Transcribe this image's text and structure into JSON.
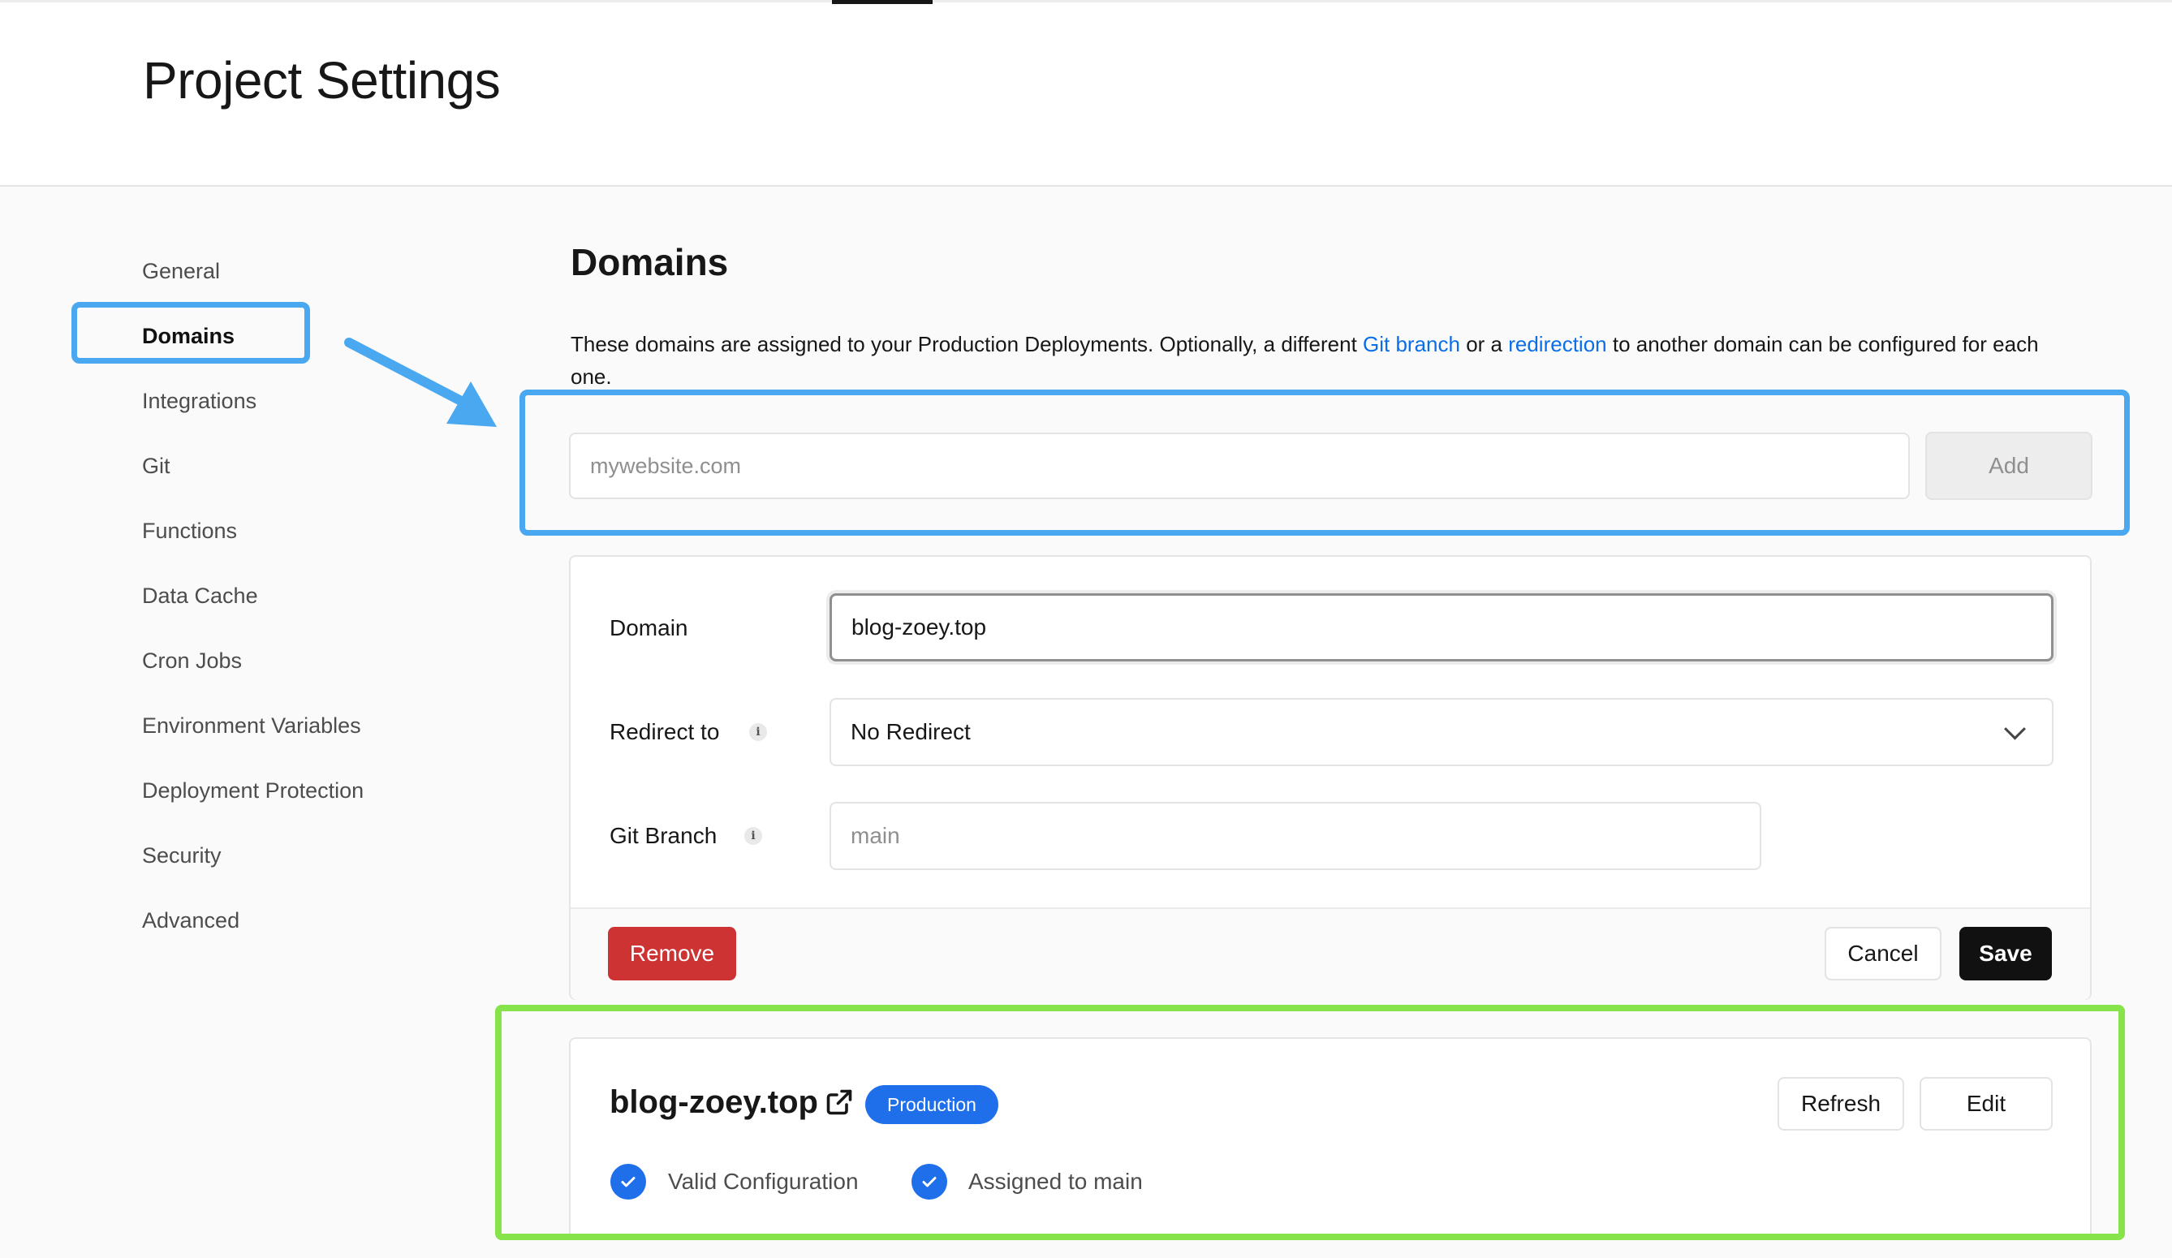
{
  "header": {
    "title": "Project Settings"
  },
  "sidebar": {
    "items": [
      {
        "label": "General"
      },
      {
        "label": "Domains"
      },
      {
        "label": "Integrations"
      },
      {
        "label": "Git"
      },
      {
        "label": "Functions"
      },
      {
        "label": "Data Cache"
      },
      {
        "label": "Cron Jobs"
      },
      {
        "label": "Environment Variables"
      },
      {
        "label": "Deployment Protection"
      },
      {
        "label": "Security"
      },
      {
        "label": "Advanced"
      }
    ],
    "active_item": "Domains"
  },
  "main": {
    "section_title": "Domains",
    "description": {
      "part1": "These domains are assigned to your Production Deployments. Optionally, a different ",
      "link1": "Git branch",
      "part2": " or a ",
      "link2": "redirection",
      "part3": " to another domain can be configured for each one."
    },
    "add_domain": {
      "placeholder": "mywebsite.com",
      "value": "",
      "button_label": "Add"
    },
    "edit_form": {
      "domain_label": "Domain",
      "domain_value": "blog-zoey.top",
      "redirect_label": "Redirect to",
      "redirect_value": "No Redirect",
      "git_branch_label": "Git Branch",
      "git_branch_placeholder": "main",
      "info_glyph": "i",
      "remove_label": "Remove",
      "cancel_label": "Cancel",
      "save_label": "Save"
    },
    "domain_card": {
      "name": "blog-zoey.top",
      "badge": "Production",
      "refresh_label": "Refresh",
      "edit_label": "Edit",
      "status": [
        {
          "label": "Valid Configuration",
          "icon": "check-circle-icon"
        },
        {
          "label": "Assigned to main",
          "icon": "check-circle-icon"
        }
      ]
    }
  },
  "colors": {
    "link": "#0a6ee8",
    "remove": "#cd3333",
    "badge": "#1f6feb",
    "annotation_blue": "#4aa8f0",
    "annotation_green": "#86e34a",
    "save": "#111111"
  }
}
